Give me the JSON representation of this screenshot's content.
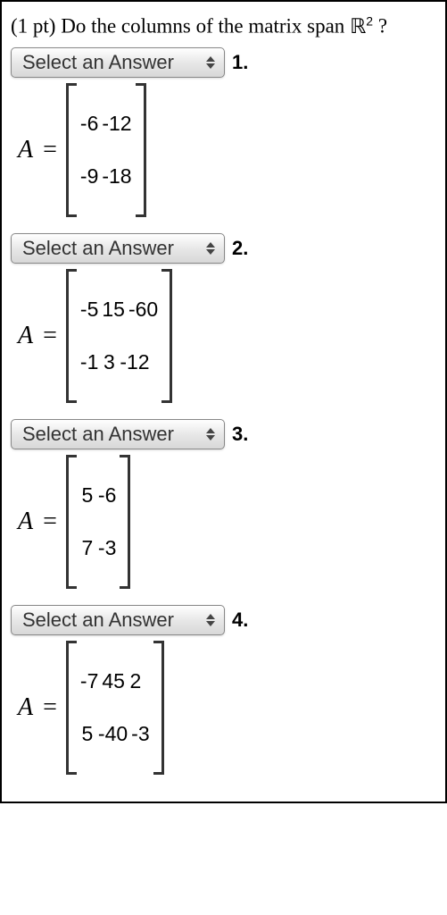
{
  "question": {
    "prefix": "(1 pt) Do the columns of the matrix span ",
    "space_symbol_prefix": "ℝ",
    "space_symbol_exp": "2",
    "suffix": " ?"
  },
  "dropdown_label": "Select an Answer",
  "problems": [
    {
      "number": "1.",
      "matrix_rows": [
        [
          "-6",
          "-12"
        ],
        [
          "-9",
          "-18"
        ]
      ]
    },
    {
      "number": "2.",
      "matrix_rows": [
        [
          "-5",
          "15",
          "-60"
        ],
        [
          "-1",
          "3",
          "-12"
        ]
      ]
    },
    {
      "number": "3.",
      "matrix_rows": [
        [
          "5",
          "-6"
        ],
        [
          "7",
          "-3"
        ]
      ]
    },
    {
      "number": "4.",
      "matrix_rows": [
        [
          "-7",
          "45",
          "2"
        ],
        [
          "5",
          "-40",
          "-3"
        ]
      ]
    }
  ]
}
